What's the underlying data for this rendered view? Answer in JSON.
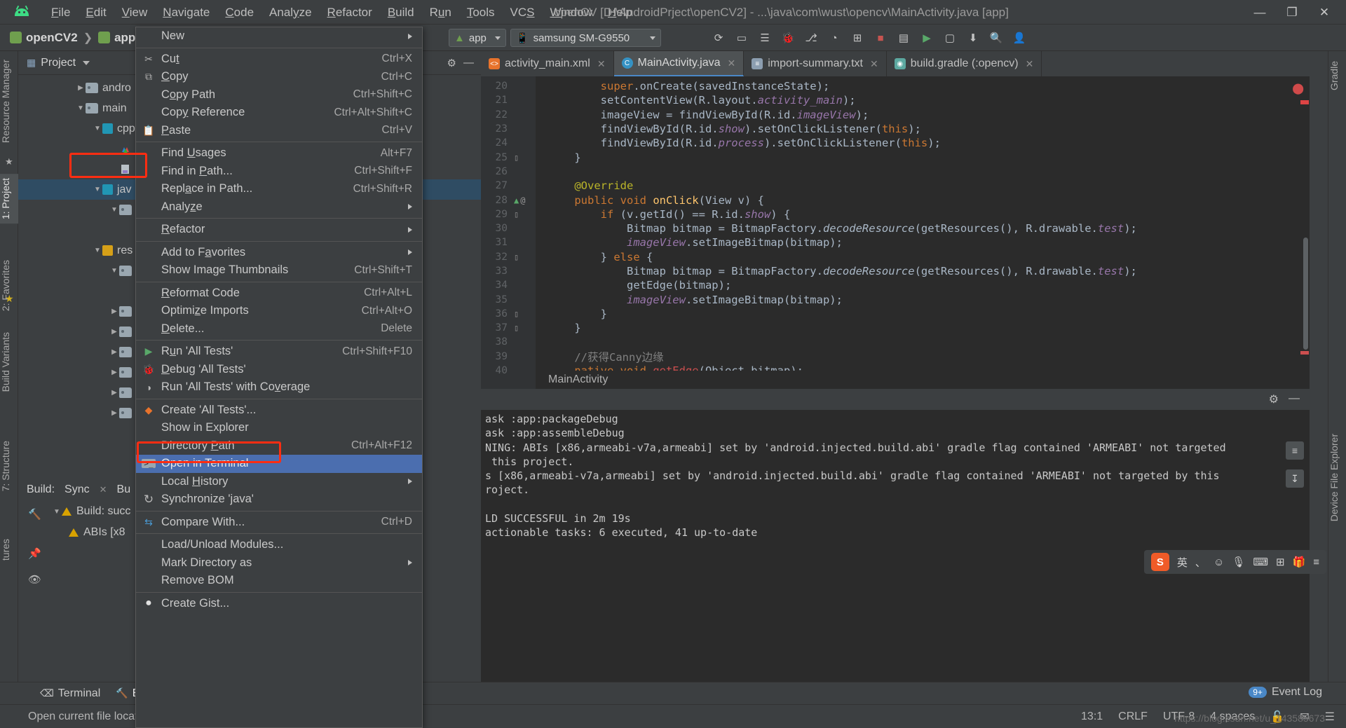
{
  "window": {
    "title": "openCV [D:\\AndroidPrject\\openCV2] - ...\\java\\com\\wust\\opencv\\MainActivity.java [app]",
    "minimize": "—",
    "maximize": "❐",
    "close": "✕"
  },
  "menubar": [
    {
      "label": "File"
    },
    {
      "label": "Edit"
    },
    {
      "label": "View"
    },
    {
      "label": "Navigate"
    },
    {
      "label": "Code"
    },
    {
      "label": "Analyze"
    },
    {
      "label": "Refactor"
    },
    {
      "label": "Build"
    },
    {
      "label": "Run"
    },
    {
      "label": "Tools"
    },
    {
      "label": "VCS"
    },
    {
      "label": "Window"
    },
    {
      "label": "Help"
    }
  ],
  "toolbar": {
    "breadcrumb": [
      {
        "label": "openCV2",
        "icon": "folder-icon"
      },
      {
        "label": "app",
        "icon": "folder-icon"
      }
    ],
    "run_config": "app",
    "device": "samsung SM-G9550",
    "icons": [
      {
        "name": "sync-gradle-icon",
        "glyph": "⟳"
      },
      {
        "name": "avd-manager-icon",
        "glyph": "▭"
      },
      {
        "name": "sdk-manager-icon",
        "glyph": "☰"
      },
      {
        "name": "debug-icon",
        "glyph": "🐞"
      },
      {
        "name": "attach-debugger-icon",
        "glyph": "⎇"
      },
      {
        "name": "profiler-icon",
        "glyph": "◔"
      },
      {
        "name": "layout-inspector-icon",
        "glyph": "⊞"
      },
      {
        "name": "stop-icon",
        "glyph": "■"
      },
      {
        "name": "project-structure-icon",
        "glyph": "▤"
      },
      {
        "name": "run-icon",
        "glyph": "▶"
      },
      {
        "name": "device-manager-icon",
        "glyph": "▢"
      },
      {
        "name": "sdk-icon",
        "glyph": "⬇"
      },
      {
        "name": "search-icon",
        "glyph": "🔍"
      },
      {
        "name": "account-icon",
        "glyph": "👤"
      }
    ]
  },
  "left_strip": [
    {
      "label": "Resource Manager"
    },
    {
      "label": "1: Project",
      "selected": true
    },
    {
      "label": "2: Favorites"
    },
    {
      "label": "Build Variants"
    },
    {
      "label": "7: Structure"
    },
    {
      "label": "tures"
    }
  ],
  "right_strip": [
    {
      "label": "Gradle"
    },
    {
      "label": "Device File Explorer"
    }
  ],
  "project_panel": {
    "title": "Project",
    "tree": [
      {
        "indent": 1,
        "twisty": "▶",
        "icon": "folder-icon",
        "label": "andro"
      },
      {
        "indent": 1,
        "twisty": "▼",
        "icon": "folder-icon",
        "label": "main"
      },
      {
        "indent": 2,
        "twisty": "▼",
        "icon": "blue-icon",
        "label": "cpp"
      },
      {
        "indent": 3,
        "twisty": "",
        "icon": "opencv-icon",
        "label": ""
      },
      {
        "indent": 3,
        "twisty": "",
        "icon": "doc-icon",
        "label": ""
      },
      {
        "indent": 2,
        "twisty": "▼",
        "icon": "blue-icon",
        "label": "jav",
        "selected": true
      },
      {
        "indent": 3,
        "twisty": "▼",
        "icon": "folder-icon",
        "label": ""
      },
      {
        "indent": 3,
        "twisty": "",
        "icon": "",
        "label": ""
      },
      {
        "indent": 2,
        "twisty": "▼",
        "icon": "res-icon",
        "label": "res"
      },
      {
        "indent": 3,
        "twisty": "▼",
        "icon": "folder-icon",
        "label": ""
      },
      {
        "indent": 3,
        "twisty": "",
        "icon": "",
        "label": ""
      },
      {
        "indent": 3,
        "twisty": "▶",
        "icon": "folder-icon",
        "label": ""
      },
      {
        "indent": 3,
        "twisty": "▶",
        "icon": "folder-icon",
        "label": ""
      },
      {
        "indent": 3,
        "twisty": "▶",
        "icon": "folder-icon",
        "label": ""
      },
      {
        "indent": 3,
        "twisty": "▶",
        "icon": "folder-icon",
        "label": ""
      },
      {
        "indent": 3,
        "twisty": "▶",
        "icon": "folder-icon",
        "label": ""
      },
      {
        "indent": 3,
        "twisty": "▶",
        "icon": "folder-icon",
        "label": ""
      }
    ]
  },
  "build_panel": {
    "tabs": [
      {
        "label": "Build:"
      },
      {
        "label": "Sync",
        "close": "✕"
      },
      {
        "label": "Bu"
      }
    ],
    "rows": [
      {
        "twisty": "▼",
        "warn": true,
        "label": "Build: succ"
      },
      {
        "twisty": "",
        "warn": true,
        "label": "ABIs [x8"
      }
    ]
  },
  "editor": {
    "tabs": [
      {
        "label": "activity_main.xml",
        "icon": "xml-layout-icon",
        "icon_color": "#e8732c",
        "icon_glyph": "<>",
        "active": false,
        "close": "✕"
      },
      {
        "label": "MainActivity.java",
        "icon": "java-class-icon",
        "icon_color": "#3592c4",
        "icon_glyph": "C",
        "active": true,
        "close": "✕"
      },
      {
        "label": "import-summary.txt",
        "icon": "text-file-icon",
        "icon_color": "#8c9eb0",
        "icon_glyph": "≡",
        "active": false,
        "close": "✕"
      },
      {
        "label": "build.gradle (:opencv)",
        "icon": "gradle-icon",
        "icon_color": "#5ca8a0",
        "icon_glyph": "◉",
        "active": false,
        "close": "✕"
      }
    ],
    "breadcrumb": "MainActivity",
    "lines": [
      {
        "n": "20",
        "mark": "",
        "tokens": [
          {
            "t": "        ",
            "c": "pln"
          },
          {
            "t": "super",
            "c": "kw"
          },
          {
            "t": ".onCreate(savedInstanceState);",
            "c": "pln"
          }
        ]
      },
      {
        "n": "21",
        "mark": "",
        "tokens": [
          {
            "t": "        setContentView(R.layout.",
            "c": "pln"
          },
          {
            "t": "activity_main",
            "c": "fld"
          },
          {
            "t": ");",
            "c": "pln"
          }
        ]
      },
      {
        "n": "22",
        "mark": "",
        "tokens": [
          {
            "t": "        imageView = findViewById(R.id.",
            "c": "pln"
          },
          {
            "t": "imageView",
            "c": "fld"
          },
          {
            "t": ");",
            "c": "pln"
          }
        ]
      },
      {
        "n": "23",
        "mark": "",
        "tokens": [
          {
            "t": "        findViewById(R.id.",
            "c": "pln"
          },
          {
            "t": "show",
            "c": "fld"
          },
          {
            "t": ").setOnClickListener(",
            "c": "pln"
          },
          {
            "t": "this",
            "c": "kw"
          },
          {
            "t": ");",
            "c": "pln"
          }
        ]
      },
      {
        "n": "24",
        "mark": "",
        "tokens": [
          {
            "t": "        findViewById(R.id.",
            "c": "pln"
          },
          {
            "t": "process",
            "c": "fld"
          },
          {
            "t": ").setOnClickListener(",
            "c": "pln"
          },
          {
            "t": "this",
            "c": "kw"
          },
          {
            "t": ");",
            "c": "pln"
          }
        ]
      },
      {
        "n": "25",
        "mark": "fold",
        "tokens": [
          {
            "t": "    }",
            "c": "pln"
          }
        ]
      },
      {
        "n": "26",
        "mark": "",
        "tokens": [
          {
            "t": "",
            "c": "pln"
          }
        ]
      },
      {
        "n": "27",
        "mark": "",
        "tokens": [
          {
            "t": "    ",
            "c": "pln"
          },
          {
            "t": "@Override",
            "c": "ann"
          }
        ]
      },
      {
        "n": "28",
        "mark": "override",
        "tokens": [
          {
            "t": "    ",
            "c": "pln"
          },
          {
            "t": "public void ",
            "c": "kw"
          },
          {
            "t": "onClick",
            "c": "mth"
          },
          {
            "t": "(View v) {",
            "c": "pln"
          }
        ]
      },
      {
        "n": "29",
        "mark": "fold",
        "tokens": [
          {
            "t": "        ",
            "c": "pln"
          },
          {
            "t": "if",
            "c": "kw"
          },
          {
            "t": " (v.getId() == R.id.",
            "c": "pln"
          },
          {
            "t": "show",
            "c": "fld"
          },
          {
            "t": ") {",
            "c": "pln"
          }
        ]
      },
      {
        "n": "30",
        "mark": "",
        "tokens": [
          {
            "t": "            Bitmap bitmap = BitmapFactory.",
            "c": "pln"
          },
          {
            "t": "decodeResource",
            "c": "mthi"
          },
          {
            "t": "(getResources(), R.drawable.",
            "c": "pln"
          },
          {
            "t": "test",
            "c": "fld"
          },
          {
            "t": ");",
            "c": "pln"
          }
        ]
      },
      {
        "n": "31",
        "mark": "",
        "tokens": [
          {
            "t": "            ",
            "c": "pln"
          },
          {
            "t": "imageView",
            "c": "fld"
          },
          {
            "t": ".setImageBitmap(bitmap);",
            "c": "pln"
          }
        ]
      },
      {
        "n": "32",
        "mark": "fold",
        "tokens": [
          {
            "t": "        } ",
            "c": "pln"
          },
          {
            "t": "else",
            "c": "kw"
          },
          {
            "t": " {",
            "c": "pln"
          }
        ]
      },
      {
        "n": "33",
        "mark": "",
        "tokens": [
          {
            "t": "            Bitmap bitmap = BitmapFactory.",
            "c": "pln"
          },
          {
            "t": "decodeResource",
            "c": "mthi"
          },
          {
            "t": "(getResources(), R.drawable.",
            "c": "pln"
          },
          {
            "t": "test",
            "c": "fld"
          },
          {
            "t": ");",
            "c": "pln"
          }
        ]
      },
      {
        "n": "34",
        "mark": "",
        "tokens": [
          {
            "t": "            getEdge(bitmap);",
            "c": "pln"
          }
        ]
      },
      {
        "n": "35",
        "mark": "",
        "tokens": [
          {
            "t": "            ",
            "c": "pln"
          },
          {
            "t": "imageView",
            "c": "fld"
          },
          {
            "t": ".setImageBitmap(bitmap);",
            "c": "pln"
          }
        ]
      },
      {
        "n": "36",
        "mark": "fold",
        "tokens": [
          {
            "t": "        }",
            "c": "pln"
          }
        ]
      },
      {
        "n": "37",
        "mark": "fold",
        "tokens": [
          {
            "t": "    }",
            "c": "pln"
          }
        ]
      },
      {
        "n": "38",
        "mark": "",
        "tokens": [
          {
            "t": "",
            "c": "pln"
          }
        ]
      },
      {
        "n": "39",
        "mark": "",
        "tokens": [
          {
            "t": "    ",
            "c": "pln"
          },
          {
            "t": "//获得Canny边缘",
            "c": "cmt"
          }
        ]
      },
      {
        "n": "40",
        "mark": "",
        "tokens": [
          {
            "t": "    ",
            "c": "pln"
          },
          {
            "t": "native void ",
            "c": "kw"
          },
          {
            "t": "getEdge",
            "c": "err"
          },
          {
            "t": "(Object bitmap);",
            "c": "pln"
          }
        ]
      }
    ]
  },
  "output": {
    "lines": [
      "ask :app:packageDebug",
      "ask :app:assembleDebug",
      "NING: ABIs [x86,armeabi-v7a,armeabi] set by 'android.injected.build.abi' gradle flag contained 'ARMEABI' not targeted",
      " this project.",
      "s [x86,armeabi-v7a,armeabi] set by 'android.injected.build.abi' gradle flag contained 'ARMEABI' not targeted by this",
      "roject.",
      "",
      "LD SUCCESSFUL in 2m 19s",
      "actionable tasks: 6 executed, 41 up-to-date"
    ]
  },
  "context_menu": {
    "items": [
      {
        "id": "new",
        "label": "New",
        "shortcut": "",
        "icon": "",
        "submenu": true
      },
      {
        "sep": true
      },
      {
        "id": "cut",
        "label": "Cut",
        "underline": "t",
        "shortcut": "Ctrl+X",
        "icon": "scissors-icon",
        "icon_glyph": "✂"
      },
      {
        "id": "copy",
        "label": "Copy",
        "underline": "C",
        "shortcut": "Ctrl+C",
        "icon": "copy-icon",
        "icon_glyph": "⧉"
      },
      {
        "id": "copy-path",
        "label": "Copy Path",
        "underline": "o",
        "shortcut": "Ctrl+Shift+C",
        "icon": ""
      },
      {
        "id": "copy-reference",
        "label": "Copy Reference",
        "underline": "y",
        "shortcut": "Ctrl+Alt+Shift+C",
        "icon": ""
      },
      {
        "id": "paste",
        "label": "Paste",
        "underline": "P",
        "shortcut": "Ctrl+V",
        "icon": "clipboard-icon",
        "icon_glyph": "📋"
      },
      {
        "sep": true
      },
      {
        "id": "find-usages",
        "label": "Find Usages",
        "underline": "U",
        "shortcut": "Alt+F7",
        "icon": ""
      },
      {
        "id": "find-in-path",
        "label": "Find in Path...",
        "underline": "P",
        "shortcut": "Ctrl+Shift+F",
        "icon": ""
      },
      {
        "id": "replace-in-path",
        "label": "Replace in Path...",
        "underline": "a",
        "shortcut": "Ctrl+Shift+R",
        "icon": ""
      },
      {
        "id": "analyze",
        "label": "Analyze",
        "underline": "z",
        "shortcut": "",
        "icon": "",
        "submenu": true
      },
      {
        "sep": true
      },
      {
        "id": "refactor",
        "label": "Refactor",
        "underline": "R",
        "shortcut": "",
        "icon": "",
        "submenu": true
      },
      {
        "sep": true
      },
      {
        "id": "add-to-favorites",
        "label": "Add to Favorites",
        "underline": "a",
        "shortcut": "",
        "icon": "",
        "submenu": true
      },
      {
        "id": "show-image-thumbnails",
        "label": "Show Image Thumbnails",
        "shortcut": "Ctrl+Shift+T",
        "icon": ""
      },
      {
        "sep": true
      },
      {
        "id": "reformat-code",
        "label": "Reformat Code",
        "underline": "R",
        "shortcut": "Ctrl+Alt+L",
        "icon": ""
      },
      {
        "id": "optimize-imports",
        "label": "Optimize Imports",
        "underline": "z",
        "shortcut": "Ctrl+Alt+O",
        "icon": ""
      },
      {
        "id": "delete",
        "label": "Delete...",
        "underline": "D",
        "shortcut": "Delete",
        "icon": ""
      },
      {
        "sep": true
      },
      {
        "id": "run-all-tests",
        "label": "Run 'All Tests'",
        "underline": "u",
        "shortcut": "Ctrl+Shift+F10",
        "icon": "run-icon",
        "icon_glyph": "▶"
      },
      {
        "id": "debug-all-tests",
        "label": "Debug 'All Tests'",
        "underline": "D",
        "shortcut": "",
        "icon": "debug-icon",
        "icon_glyph": "🐞"
      },
      {
        "id": "run-with-coverage",
        "label": "Run 'All Tests' with Coverage",
        "underline": "v",
        "shortcut": "",
        "icon": "coverage-icon",
        "icon_glyph": "◑"
      },
      {
        "sep": true
      },
      {
        "id": "create-all-tests",
        "label": "Create 'All Tests'...",
        "shortcut": "",
        "icon": "create-config-icon",
        "icon_glyph": "◆"
      },
      {
        "id": "show-in-explorer",
        "label": "Show in Explorer",
        "shortcut": "",
        "icon": ""
      },
      {
        "id": "directory-path",
        "label": "Directory Path",
        "underline": "P",
        "shortcut": "Ctrl+Alt+F12",
        "icon": ""
      },
      {
        "id": "open-in-terminal",
        "label": "Open in Terminal",
        "shortcut": "",
        "icon": "terminal-icon",
        "icon_glyph": "⌫",
        "selected": true
      },
      {
        "id": "local-history",
        "label": "Local History",
        "underline": "H",
        "shortcut": "",
        "icon": "",
        "submenu": true
      },
      {
        "id": "synchronize-java",
        "label": "Synchronize 'java'",
        "shortcut": "",
        "icon": "sync-icon",
        "icon_glyph": "↻"
      },
      {
        "sep": true
      },
      {
        "id": "compare-with",
        "label": "Compare With...",
        "shortcut": "Ctrl+D",
        "icon": "compare-icon",
        "icon_glyph": "⇆"
      },
      {
        "sep": true
      },
      {
        "id": "load-unload-modules",
        "label": "Load/Unload Modules...",
        "shortcut": "",
        "icon": ""
      },
      {
        "id": "mark-directory-as",
        "label": "Mark Directory as",
        "shortcut": "",
        "icon": "",
        "submenu": true
      },
      {
        "id": "remove-bom",
        "label": "Remove BOM",
        "shortcut": "",
        "icon": ""
      },
      {
        "sep": true
      },
      {
        "id": "create-gist",
        "label": "Create Gist...",
        "shortcut": "",
        "icon": "github-icon",
        "icon_glyph": "●"
      }
    ]
  },
  "bottom_tabs": [
    {
      "label": "Terminal",
      "icon": "terminal-icon",
      "icon_glyph": "⌫",
      "active": false
    },
    {
      "label": "Build",
      "icon": "build-icon",
      "icon_glyph": "🔨",
      "active": true
    }
  ],
  "statusbar": {
    "message": "Open current file locat",
    "caret": "13:1",
    "line_sep": "CRLF",
    "encoding": "UTF-8",
    "indent": "4 spaces",
    "lock": "🔓"
  },
  "event_log": {
    "label": "Event Log",
    "badge": "9+"
  },
  "ime": {
    "logo": "S",
    "lang": "英",
    "items": [
      "、",
      "☺",
      "🎙",
      "⌨",
      "⊞",
      "🎁",
      "≡"
    ]
  },
  "watermark": "https://blog.csdn.net/u_143585673"
}
